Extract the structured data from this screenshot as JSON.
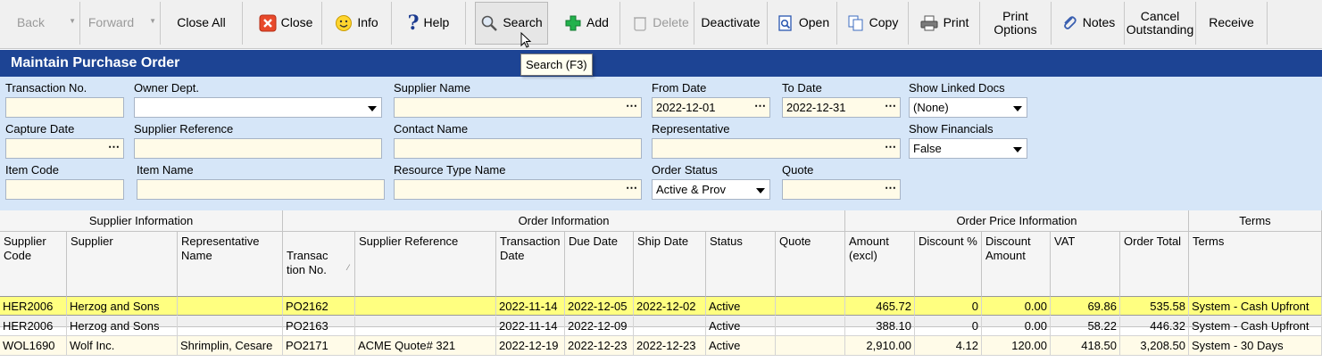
{
  "toolbar": {
    "back": "Back",
    "forward": "Forward",
    "close_all": "Close All",
    "close": "Close",
    "info": "Info",
    "help": "Help",
    "search": "Search",
    "add": "Add",
    "delete": "Delete",
    "deactivate": "Deactivate",
    "open": "Open",
    "copy": "Copy",
    "print": "Print",
    "print_options": "Print\nOptions",
    "notes": "Notes",
    "cancel_outstanding": "Cancel\nOutstanding",
    "receive": "Receive"
  },
  "tooltip": "Search (F3)",
  "title": "Maintain Purchase Order",
  "filters": {
    "transaction_no": {
      "label": "Transaction No.",
      "value": ""
    },
    "owner_dept": {
      "label": "Owner Dept.",
      "value": ""
    },
    "supplier_name": {
      "label": "Supplier Name",
      "value": ""
    },
    "from_date": {
      "label": "From Date",
      "value": "2022-12-01"
    },
    "to_date": {
      "label": "To Date",
      "value": "2022-12-31"
    },
    "show_linked_docs": {
      "label": "Show Linked Docs",
      "value": "(None)"
    },
    "capture_date": {
      "label": "Capture Date",
      "value": ""
    },
    "supplier_reference": {
      "label": "Supplier Reference",
      "value": ""
    },
    "contact_name": {
      "label": "Contact Name",
      "value": ""
    },
    "representative": {
      "label": "Representative",
      "value": ""
    },
    "show_financials": {
      "label": "Show Financials",
      "value": "False"
    },
    "item_code": {
      "label": "Item Code",
      "value": ""
    },
    "item_name": {
      "label": "Item Name",
      "value": ""
    },
    "resource_type_name": {
      "label": "Resource Type Name",
      "value": ""
    },
    "order_status": {
      "label": "Order Status",
      "value": "Active & Prov"
    },
    "quote": {
      "label": "Quote",
      "value": ""
    }
  },
  "grid": {
    "groups": {
      "supplier_info": "Supplier Information",
      "order_info": "Order Information",
      "order_price_info": "Order Price Information",
      "terms": "Terms"
    },
    "columns": {
      "supplier_code": "Supplier\nCode",
      "supplier": "Supplier",
      "rep_name": "Representative\nName",
      "transaction_no": "Transac\ntion No.",
      "supplier_ref": "Supplier Reference",
      "transaction_date": "Transaction\nDate",
      "due_date": "Due Date",
      "ship_date": "Ship Date",
      "status": "Status",
      "quote": "Quote",
      "amount_excl": "Amount\n(excl)",
      "discount_pct": "Discount %",
      "discount_amt": "Discount\nAmount",
      "vat": "VAT",
      "order_total": "Order Total",
      "terms": "Terms"
    },
    "rows": [
      [
        "HER2006",
        "Herzog and Sons",
        "",
        "PO2162",
        "",
        "2022-11-14",
        "2022-12-05",
        "2022-12-02",
        "Active",
        "",
        "465.72",
        "0",
        "0.00",
        "69.86",
        "535.58",
        "System - Cash Upfront"
      ],
      [
        "HER2006",
        "Herzog and Sons",
        "",
        "PO2163",
        "",
        "2022-11-14",
        "2022-12-09",
        "",
        "Active",
        "",
        "388.10",
        "0",
        "0.00",
        "58.22",
        "446.32",
        "System - Cash Upfront"
      ],
      [
        "WOL1690",
        "Wolf Inc.",
        "Shrimplin, Cesare",
        "PO2171",
        "ACME Quote# 321",
        "2022-12-19",
        "2022-12-23",
        "2022-12-23",
        "Active",
        "",
        "2,910.00",
        "4.12",
        "120.00",
        "418.50",
        "3,208.50",
        "System - 30 Days"
      ]
    ]
  }
}
